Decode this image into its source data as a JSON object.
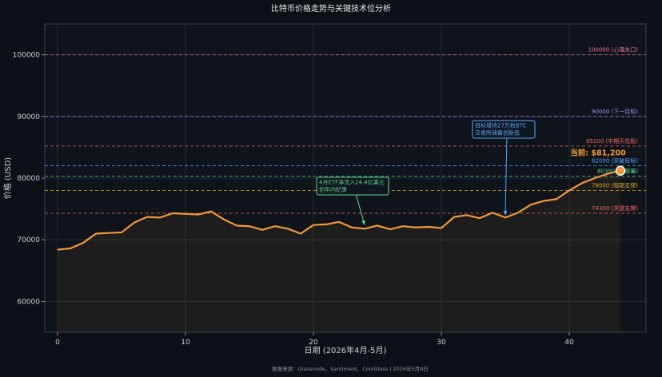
{
  "chart_data": {
    "type": "line",
    "title": "比特币价格走势与关键技术位分析",
    "xlabel": "日期 (2026年4月-5月)",
    "ylabel": "价格 (USD)",
    "xlim": [
      -1,
      46
    ],
    "ylim": [
      55000,
      105000
    ],
    "xticks": [
      0,
      10,
      20,
      30,
      40
    ],
    "yticks": [
      60000,
      70000,
      80000,
      90000,
      100000
    ],
    "grid": true,
    "series": [
      {
        "color": "#f0993a",
        "x": [
          0,
          1,
          2,
          3,
          4,
          5,
          6,
          7,
          8,
          9,
          10,
          11,
          12,
          13,
          14,
          15,
          16,
          17,
          18,
          19,
          20,
          21,
          22,
          23,
          24,
          25,
          26,
          27,
          28,
          29,
          30,
          31,
          32,
          33,
          34,
          35,
          36,
          37,
          38,
          39,
          40,
          41,
          42,
          43,
          44
        ],
        "values": [
          68400,
          68600,
          69500,
          71000,
          71100,
          71200,
          72800,
          73700,
          73600,
          74300,
          74200,
          74100,
          74600,
          73300,
          72300,
          72200,
          71600,
          72200,
          71800,
          71000,
          72400,
          72500,
          72900,
          72000,
          71800,
          72300,
          71700,
          72200,
          72000,
          72100,
          71900,
          73700,
          74000,
          73500,
          74400,
          73600,
          74400,
          75700,
          76300,
          76600,
          78000,
          79200,
          80000,
          80700,
          81200
        ]
      }
    ],
    "levels": [
      {
        "value": 100000,
        "label": "100000 (心理关口)",
        "color": "#e6739f"
      },
      {
        "value": 90000,
        "label": "90000 (下一目标)",
        "color": "#a78bfa"
      },
      {
        "value": 85200,
        "label": "85200 (中期天花板)",
        "color": "#f0675e"
      },
      {
        "value": 82000,
        "label": "82000 (突破目标)",
        "color": "#58a6ff"
      },
      {
        "value": 80300,
        "label": "80300 (新部署)",
        "color": "#5fd38d"
      },
      {
        "value": 78000,
        "label": "78000 (短期支撑)",
        "color": "#d4a72c"
      },
      {
        "value": 74300,
        "label": "74300 (关键支撑)",
        "color": "#f0675e"
      }
    ],
    "current": {
      "x": 44,
      "value": 81200,
      "label": "当前: $81,200",
      "color": "#f0993a"
    },
    "annotations": [
      {
        "lines": [
          "4月ETF净流入24.4亿美元",
          "创年内纪录"
        ],
        "target_x": 24,
        "target_y": 72000,
        "color": "#5fd38d"
      },
      {
        "lines": [
          "目标增持27万枚BTC",
          "交易所储备创新低"
        ],
        "target_x": 35,
        "target_y": 73600,
        "color": "#58a6ff"
      }
    ]
  },
  "source": "数据来源：Glassnode、Santiment、CoinGlass | 2026年5月9日"
}
